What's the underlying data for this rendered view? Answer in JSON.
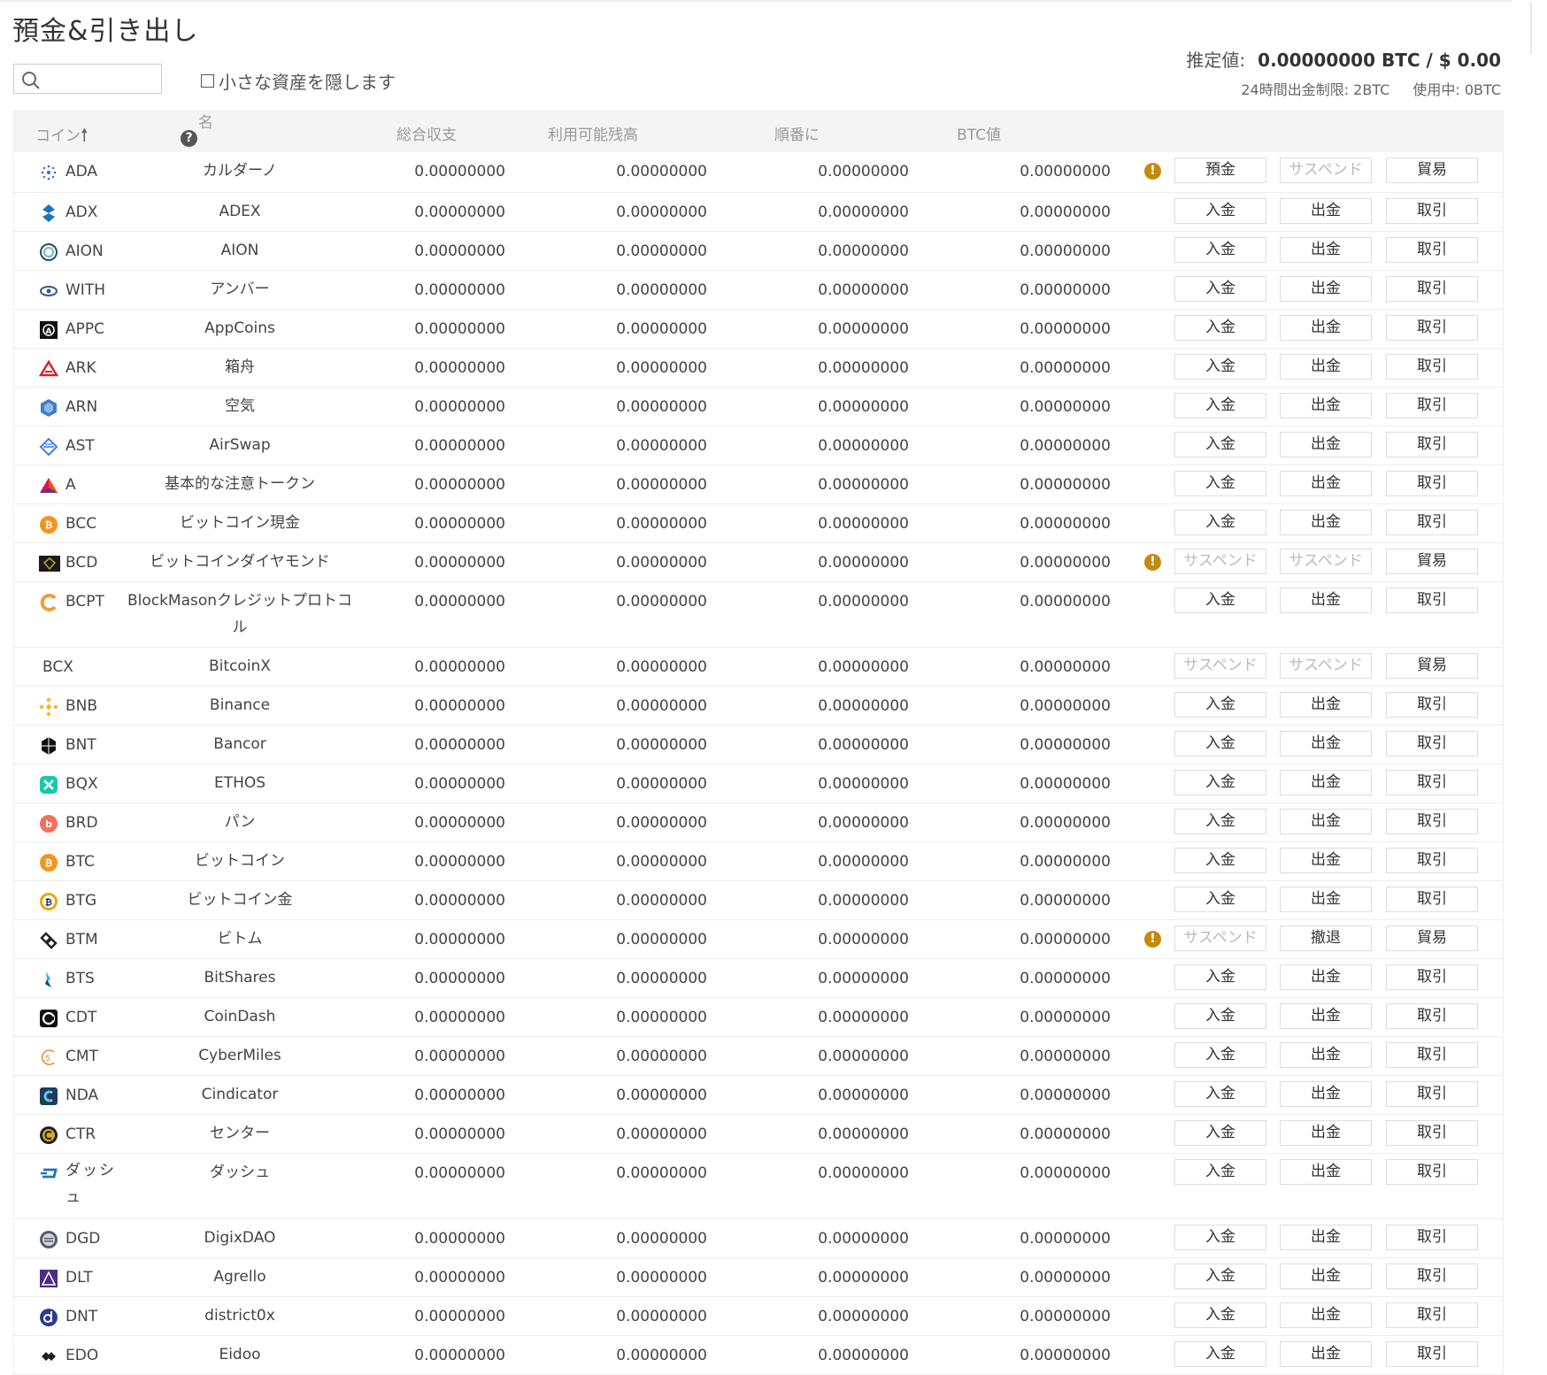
{
  "page": {
    "title": "預金&引き出し",
    "hide_small_label": "小さな資産を隠します",
    "estimated_label": "推定値:",
    "estimated_value": "0.00000000 BTC / $ 0.00",
    "limit_label": "24時間出金制限: 2BTC",
    "in_use_label": "使用中: 0BTC"
  },
  "table": {
    "headers": {
      "coin": "コイン",
      "name": "名",
      "total": "総合収支",
      "available": "利用可能残高",
      "in_order": "順番に",
      "btc_value": "BTC値"
    },
    "rows": [
      {
        "coin": "ADA",
        "name": "カルダーノ",
        "total": "0.00000000",
        "available": "0.00000000",
        "in_order": "0.00000000",
        "btc": "0.00000000",
        "warn": true,
        "b1": "預金",
        "b1_dis": false,
        "b2": "サスペンド",
        "b2_dis": true,
        "b3": "貿易",
        "icon": "ada-icon",
        "color": "#3468d1"
      },
      {
        "coin": "ADX",
        "name": "ADEX",
        "total": "0.00000000",
        "available": "0.00000000",
        "in_order": "0.00000000",
        "btc": "0.00000000",
        "warn": false,
        "b1": "入金",
        "b1_dis": false,
        "b2": "出金",
        "b2_dis": false,
        "b3": "取引",
        "icon": "adx-icon",
        "color": "#1b75bc"
      },
      {
        "coin": "AION",
        "name": "AION",
        "total": "0.00000000",
        "available": "0.00000000",
        "in_order": "0.00000000",
        "btc": "0.00000000",
        "warn": false,
        "b1": "入金",
        "b1_dis": false,
        "b2": "出金",
        "b2_dis": false,
        "b3": "取引",
        "icon": "aion-icon",
        "color": "#2a4a6a"
      },
      {
        "coin": "WITH",
        "name": "アンバー",
        "total": "0.00000000",
        "available": "0.00000000",
        "in_order": "0.00000000",
        "btc": "0.00000000",
        "warn": false,
        "b1": "入金",
        "b1_dis": false,
        "b2": "出金",
        "b2_dis": false,
        "b3": "取引",
        "icon": "eye-icon",
        "color": "#3a5a8a"
      },
      {
        "coin": "APPC",
        "name": "AppCoins",
        "total": "0.00000000",
        "available": "0.00000000",
        "in_order": "0.00000000",
        "btc": "0.00000000",
        "warn": false,
        "b1": "入金",
        "b1_dis": false,
        "b2": "出金",
        "b2_dis": false,
        "b3": "取引",
        "icon": "appc-icon",
        "color": "#111"
      },
      {
        "coin": "ARK",
        "name": "箱舟",
        "total": "0.00000000",
        "available": "0.00000000",
        "in_order": "0.00000000",
        "btc": "0.00000000",
        "warn": false,
        "b1": "入金",
        "b1_dis": false,
        "b2": "出金",
        "b2_dis": false,
        "b3": "取引",
        "icon": "ark-icon",
        "color": "#d9232d"
      },
      {
        "coin": "ARN",
        "name": "空気",
        "total": "0.00000000",
        "available": "0.00000000",
        "in_order": "0.00000000",
        "btc": "0.00000000",
        "warn": false,
        "b1": "入金",
        "b1_dis": false,
        "b2": "出金",
        "b2_dis": false,
        "b3": "取引",
        "icon": "arn-icon",
        "color": "#3f7cc9"
      },
      {
        "coin": "AST",
        "name": "AirSwap",
        "total": "0.00000000",
        "available": "0.00000000",
        "in_order": "0.00000000",
        "btc": "0.00000000",
        "warn": false,
        "b1": "入金",
        "b1_dis": false,
        "b2": "出金",
        "b2_dis": false,
        "b3": "取引",
        "icon": "ast-icon",
        "color": "#2b71ff"
      },
      {
        "coin": "A",
        "name": "基本的な注意トークン",
        "total": "0.00000000",
        "available": "0.00000000",
        "in_order": "0.00000000",
        "btc": "0.00000000",
        "warn": false,
        "b1": "入金",
        "b1_dis": false,
        "b2": "出金",
        "b2_dis": false,
        "b3": "取引",
        "icon": "bat-icon",
        "color": "#ff5000"
      },
      {
        "coin": "BCC",
        "name": "ビットコイン現金",
        "total": "0.00000000",
        "available": "0.00000000",
        "in_order": "0.00000000",
        "btc": "0.00000000",
        "warn": false,
        "b1": "入金",
        "b1_dis": false,
        "b2": "出金",
        "b2_dis": false,
        "b3": "取引",
        "icon": "bcc-icon",
        "color": "#f7931a"
      },
      {
        "coin": "BCD",
        "name": "ビットコインダイヤモンド",
        "total": "0.00000000",
        "available": "0.00000000",
        "in_order": "0.00000000",
        "btc": "0.00000000",
        "warn": true,
        "b1": "サスペンド",
        "b1_dis": true,
        "b2": "サスペンド",
        "b2_dis": true,
        "b3": "貿易",
        "icon": "bcd-icon",
        "color": "#1a1a1a"
      },
      {
        "coin": "BCPT",
        "name": "BlockMasonクレジットプロトコル",
        "total": "0.00000000",
        "available": "0.00000000",
        "in_order": "0.00000000",
        "btc": "0.00000000",
        "warn": false,
        "b1": "入金",
        "b1_dis": false,
        "b2": "出金",
        "b2_dis": false,
        "b3": "取引",
        "icon": "bcpt-icon",
        "color": "#f39c3a",
        "tall": true
      },
      {
        "coin": "BCX",
        "name": "BitcoinX",
        "total": "0.00000000",
        "available": "0.00000000",
        "in_order": "0.00000000",
        "btc": "0.00000000",
        "warn": false,
        "b1": "サスペンド",
        "b1_dis": true,
        "b2": "サスペンド",
        "b2_dis": true,
        "b3": "貿易",
        "icon": "",
        "color": "#fff"
      },
      {
        "coin": "BNB",
        "name": "Binance",
        "total": "0.00000000",
        "available": "0.00000000",
        "in_order": "0.00000000",
        "btc": "0.00000000",
        "warn": false,
        "b1": "入金",
        "b1_dis": false,
        "b2": "出金",
        "b2_dis": false,
        "b3": "取引",
        "icon": "bnb-icon",
        "color": "#f3ba2f"
      },
      {
        "coin": "BNT",
        "name": "Bancor",
        "total": "0.00000000",
        "available": "0.00000000",
        "in_order": "0.00000000",
        "btc": "0.00000000",
        "warn": false,
        "b1": "入金",
        "b1_dis": false,
        "b2": "出金",
        "b2_dis": false,
        "b3": "取引",
        "icon": "bnt-icon",
        "color": "#111"
      },
      {
        "coin": "BQX",
        "name": "ETHOS",
        "total": "0.00000000",
        "available": "0.00000000",
        "in_order": "0.00000000",
        "btc": "0.00000000",
        "warn": false,
        "b1": "入金",
        "b1_dis": false,
        "b2": "出金",
        "b2_dis": false,
        "b3": "取引",
        "icon": "bqx-icon",
        "color": "#18c9a8"
      },
      {
        "coin": "BRD",
        "name": "パン",
        "total": "0.00000000",
        "available": "0.00000000",
        "in_order": "0.00000000",
        "btc": "0.00000000",
        "warn": false,
        "b1": "入金",
        "b1_dis": false,
        "b2": "出金",
        "b2_dis": false,
        "b3": "取引",
        "icon": "brd-icon",
        "color": "#f2715c"
      },
      {
        "coin": "BTC",
        "name": "ビットコイン",
        "total": "0.00000000",
        "available": "0.00000000",
        "in_order": "0.00000000",
        "btc": "0.00000000",
        "warn": false,
        "b1": "入金",
        "b1_dis": false,
        "b2": "出金",
        "b2_dis": false,
        "b3": "取引",
        "icon": "btc-icon",
        "color": "#f7931a"
      },
      {
        "coin": "BTG",
        "name": "ビットコイン金",
        "total": "0.00000000",
        "available": "0.00000000",
        "in_order": "0.00000000",
        "btc": "0.00000000",
        "warn": false,
        "b1": "入金",
        "b1_dis": false,
        "b2": "出金",
        "b2_dis": false,
        "b3": "取引",
        "icon": "btg-icon",
        "color": "#eba809"
      },
      {
        "coin": "BTM",
        "name": "ビトム",
        "total": "0.00000000",
        "available": "0.00000000",
        "in_order": "0.00000000",
        "btc": "0.00000000",
        "warn": true,
        "b1": "サスペンド",
        "b1_dis": true,
        "b2": "撤退",
        "b2_dis": false,
        "b3": "貿易",
        "icon": "btm-icon",
        "color": "#222"
      },
      {
        "coin": "BTS",
        "name": "BitShares",
        "total": "0.00000000",
        "available": "0.00000000",
        "in_order": "0.00000000",
        "btc": "0.00000000",
        "warn": false,
        "b1": "入金",
        "b1_dis": false,
        "b2": "出金",
        "b2_dis": false,
        "b3": "取引",
        "icon": "bts-icon",
        "color": "#35baeb"
      },
      {
        "coin": "CDT",
        "name": "CoinDash",
        "total": "0.00000000",
        "available": "0.00000000",
        "in_order": "0.00000000",
        "btc": "0.00000000",
        "warn": false,
        "b1": "入金",
        "b1_dis": false,
        "b2": "出金",
        "b2_dis": false,
        "b3": "取引",
        "icon": "cdt-icon",
        "color": "#111"
      },
      {
        "coin": "CMT",
        "name": "CyberMiles",
        "total": "0.00000000",
        "available": "0.00000000",
        "in_order": "0.00000000",
        "btc": "0.00000000",
        "warn": false,
        "b1": "入金",
        "b1_dis": false,
        "b2": "出金",
        "b2_dis": false,
        "b3": "取引",
        "icon": "cmt-icon",
        "color": "#e08f3c"
      },
      {
        "coin": "NDA",
        "name": "Cindicator",
        "total": "0.00000000",
        "available": "0.00000000",
        "in_order": "0.00000000",
        "btc": "0.00000000",
        "warn": false,
        "b1": "入金",
        "b1_dis": false,
        "b2": "出金",
        "b2_dis": false,
        "b3": "取引",
        "icon": "nda-icon",
        "color": "#1d3c5a"
      },
      {
        "coin": "CTR",
        "name": "センター",
        "total": "0.00000000",
        "available": "0.00000000",
        "in_order": "0.00000000",
        "btc": "0.00000000",
        "warn": false,
        "b1": "入金",
        "b1_dis": false,
        "b2": "出金",
        "b2_dis": false,
        "b3": "取引",
        "icon": "ctr-icon",
        "color": "#1f1f1f"
      },
      {
        "coin": "ダッシュ",
        "name": "ダッシュ",
        "total": "0.00000000",
        "available": "0.00000000",
        "in_order": "0.00000000",
        "btc": "0.00000000",
        "warn": false,
        "b1": "入金",
        "b1_dis": false,
        "b2": "出金",
        "b2_dis": false,
        "b3": "取引",
        "icon": "dash-icon",
        "color": "#1c75bc",
        "tall": true
      },
      {
        "coin": "DGD",
        "name": "DigixDAO",
        "total": "0.00000000",
        "available": "0.00000000",
        "in_order": "0.00000000",
        "btc": "0.00000000",
        "warn": false,
        "b1": "入金",
        "b1_dis": false,
        "b2": "出金",
        "b2_dis": false,
        "b3": "取引",
        "icon": "dgd-icon",
        "color": "#5a5a6a"
      },
      {
        "coin": "DLT",
        "name": "Agrello",
        "total": "0.00000000",
        "available": "0.00000000",
        "in_order": "0.00000000",
        "btc": "0.00000000",
        "warn": false,
        "b1": "入金",
        "b1_dis": false,
        "b2": "出金",
        "b2_dis": false,
        "b3": "取引",
        "icon": "dlt-icon",
        "color": "#4b2e83"
      },
      {
        "coin": "DNT",
        "name": "district0x",
        "total": "0.00000000",
        "available": "0.00000000",
        "in_order": "0.00000000",
        "btc": "0.00000000",
        "warn": false,
        "b1": "入金",
        "b1_dis": false,
        "b2": "出金",
        "b2_dis": false,
        "b3": "取引",
        "icon": "dnt-icon",
        "color": "#2c398f"
      },
      {
        "coin": "EDO",
        "name": "Eidoo",
        "total": "0.00000000",
        "available": "0.00000000",
        "in_order": "0.00000000",
        "btc": "0.00000000",
        "warn": false,
        "b1": "入金",
        "b1_dis": false,
        "b2": "出金",
        "b2_dis": false,
        "b3": "取引",
        "icon": "edo-icon",
        "color": "#222"
      }
    ]
  }
}
